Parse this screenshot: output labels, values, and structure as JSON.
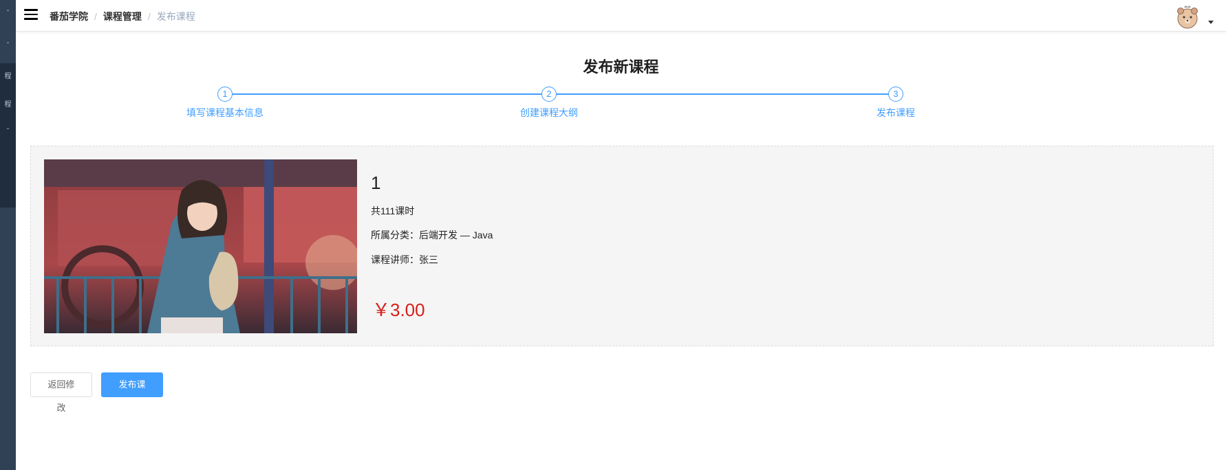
{
  "sidebar": {
    "glyphs": [
      "ˇ",
      "ˇ",
      "程",
      "程",
      "ˇ"
    ]
  },
  "breadcrumb": {
    "items": [
      "番茄学院",
      "课程管理",
      "发布课程"
    ],
    "separator": "/"
  },
  "page": {
    "title": "发布新课程"
  },
  "steps": [
    {
      "number": "1",
      "label": "填写课程基本信息"
    },
    {
      "number": "2",
      "label": "创建课程大纲"
    },
    {
      "number": "3",
      "label": "发布课程"
    }
  ],
  "course": {
    "title": "1",
    "lessons": "共111课时",
    "category_label": "所属分类：",
    "category_value": "后端开发 — Java",
    "teacher_label": "课程讲师：",
    "teacher_value": "张三",
    "price": "￥3.00"
  },
  "buttons": {
    "back": "返回修改",
    "publish": "发布课程"
  },
  "colors": {
    "primary": "#409eff",
    "price": "#d91e18",
    "sidebar": "#304156",
    "card_bg": "#f5f5f5"
  },
  "icons": {
    "menu": "hamburger-icon",
    "avatar": "bear-avatar",
    "dropdown": "caret-down-icon"
  }
}
